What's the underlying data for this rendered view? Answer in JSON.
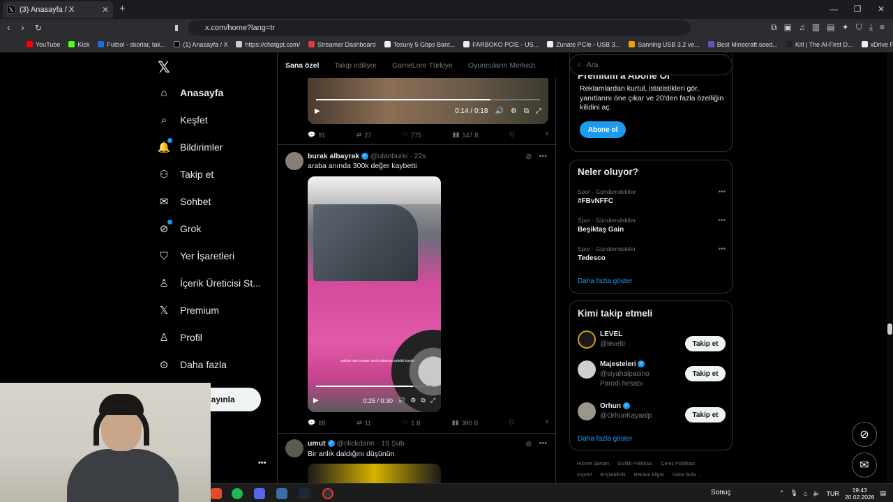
{
  "browser": {
    "tab_title": "(3) Anasayfa / X",
    "url": "x.com/home?lang=tr",
    "bookmarks": [
      "YouTube",
      "Kick",
      "Futbol - skorlar, tak...",
      "(1) Anasayfa / X",
      "https://chatgpt.com/",
      "Streamer Dashboard",
      "Tosuny 5 Gbps Bant...",
      "FARBOKO PCIE - US...",
      "Zunate PCIe - USB 3...",
      "Sanning USB 3.2 ve...",
      "Best Minecraft seed...",
      "Kitl | The AI-First D...",
      "xDrive Fırtına Profes..."
    ]
  },
  "sidebar": {
    "items": [
      {
        "label": "Anasayfa",
        "icon": "home-icon"
      },
      {
        "label": "Keşfet",
        "icon": "search-icon"
      },
      {
        "label": "Bildirimler",
        "icon": "bell-icon"
      },
      {
        "label": "Takip et",
        "icon": "add-user-icon"
      },
      {
        "label": "Sohbet",
        "icon": "mail-icon"
      },
      {
        "label": "Grok",
        "icon": "grok-icon"
      },
      {
        "label": "Yer İşaretleri",
        "icon": "bookmark-icon"
      },
      {
        "label": "İçerik Üreticisi St...",
        "icon": "creator-icon"
      },
      {
        "label": "Premium",
        "icon": "x-icon"
      },
      {
        "label": "Profil",
        "icon": "profile-icon"
      },
      {
        "label": "Daha fazla",
        "icon": "more-icon"
      }
    ],
    "post_label": "yayınla"
  },
  "feed": {
    "tabs": [
      "Sana özel",
      "Takip ediliyor",
      "GameLore Türkiye",
      "Oyuncuların Merkezi"
    ],
    "top_video": {
      "time": "0:14 / 0:18",
      "progress": 0.78
    },
    "top_actions": {
      "replies": "91",
      "reposts": "27",
      "likes": "775",
      "views": "147 B"
    },
    "post1": {
      "name": "burak albayrak",
      "handle": "@ulanburki",
      "time": "22s",
      "text": "araba anında 300k değer kaybetti",
      "video_time": "0:25 / 0:30",
      "progress": 0.83,
      "video_caption": "sobsin mini cooper tercih etmenin sebebi buydu",
      "replies": "68",
      "reposts": "11",
      "likes": "1 B",
      "views": "390 B"
    },
    "post2": {
      "name": "umut",
      "handle": "@clickdann",
      "time": "19 Şub",
      "text": "Bir anlık daldığını düşünün"
    }
  },
  "right": {
    "search_placeholder": "Ara",
    "premium": {
      "title": "Premium'a Abone Ol",
      "text": "Reklamlardan kurtul, istatistikleri gör, yanıtlarını öne çıkar ve 20'den fazla özelliğin kilidini aç.",
      "button": "Abone ol"
    },
    "trends": {
      "title": "Neler oluyor?",
      "items": [
        {
          "category": "Spor · Gündemdekiler",
          "name": "#FBvNFFC"
        },
        {
          "category": "Spor · Gündemdekiler",
          "name": "Beşiktaş Gain"
        },
        {
          "category": "Spor · Gündemdekiler",
          "name": "Tedesco"
        }
      ],
      "more": "Daha fazla göster"
    },
    "who_to_follow": {
      "title": "Kimi takip etmeli",
      "items": [
        {
          "name": "LEVEL",
          "handle": "@leveltr",
          "extra": ""
        },
        {
          "name": "Majesteleri",
          "handle": "@siyahalpacino",
          "extra": "Parodi hesabı"
        },
        {
          "name": "Orhun",
          "handle": "@OrhunKayaalp",
          "extra": ""
        }
      ],
      "follow_label": "Takip et",
      "more": "Daha fazla göster"
    },
    "footer": [
      "Hizmet Şartları",
      "Gizlilik Politikası",
      "Çerez Politikası",
      "Imprint",
      "Erişilebilirlik",
      "Reklam bilgisi",
      "Daha fazla ..."
    ]
  },
  "taskbar": {
    "sonuc": "Sonuç",
    "lang": "TUR",
    "time": "19:43",
    "date": "20.02.2026"
  }
}
